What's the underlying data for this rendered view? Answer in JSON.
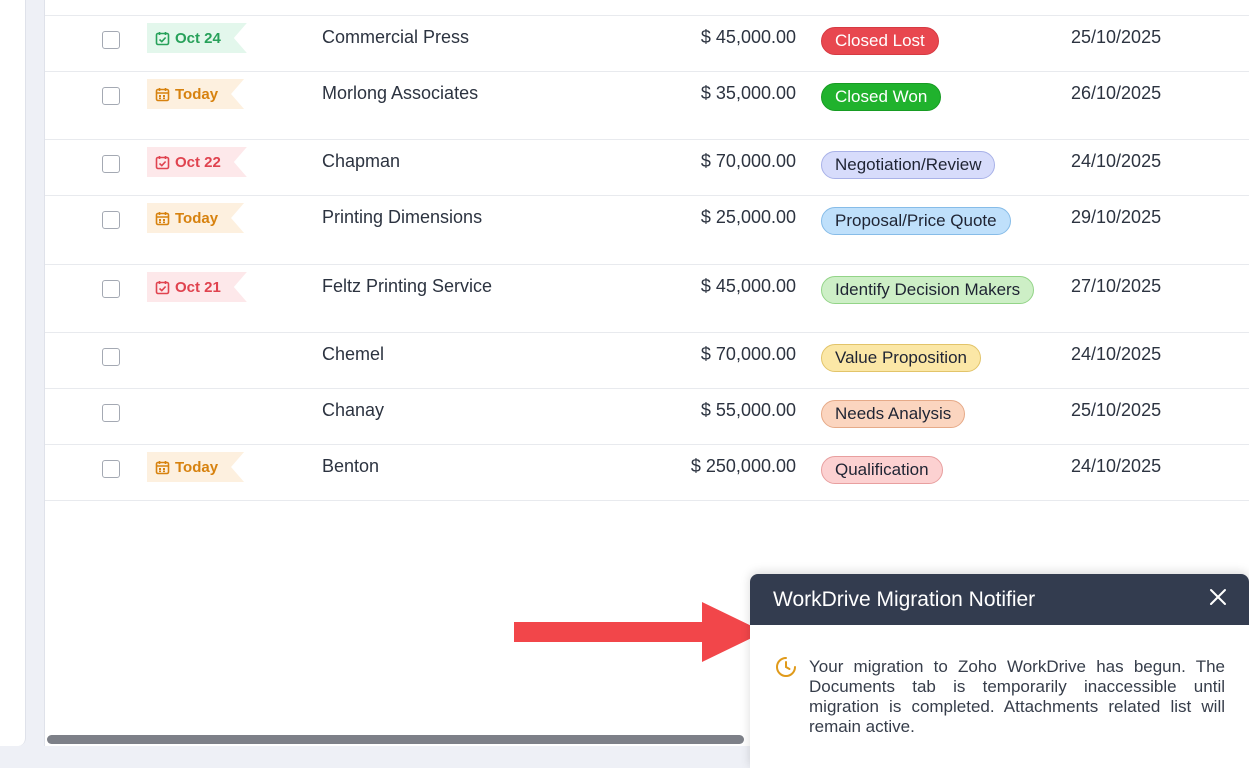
{
  "colors": {
    "header_bg": "#333c4f",
    "arrow": "#f2464a",
    "flag_green": "#27a15a",
    "flag_orange": "#d7820f",
    "flag_red": "#e0434f"
  },
  "rows": [
    {
      "flag": "Oct 24",
      "flag_color": "green",
      "flag_icon": "calendar-check-icon",
      "deal": "Commercial Press",
      "amount": "$ 45,000.00",
      "stage": "Closed Lost",
      "stage_bg": "#e8474f",
      "stage_fg": "#ffffff",
      "stage_border": "#d63a42",
      "date": "25/10/2025"
    },
    {
      "flag": "Today",
      "flag_color": "orange",
      "flag_icon": "calendar-icon",
      "deal": "Morlong Associates",
      "amount": "$ 35,000.00",
      "stage": "Closed Won",
      "stage_bg": "#20b22d",
      "stage_fg": "#ffffff",
      "stage_border": "#179c23",
      "date": "26/10/2025"
    },
    {
      "flag": "Oct 22",
      "flag_color": "red",
      "flag_icon": "calendar-check-icon",
      "deal": "Chapman",
      "amount": "$ 70,000.00",
      "stage": "Negotiation/Review",
      "stage_bg": "#d7dcfb",
      "stage_fg": "#1f2433",
      "stage_border": "#a9b2e8",
      "date": "24/10/2025"
    },
    {
      "flag": "Today",
      "flag_color": "orange",
      "flag_icon": "calendar-icon",
      "deal": "Printing Dimensions",
      "amount": "$ 25,000.00",
      "stage": "Proposal/Price Quote",
      "stage_bg": "#bfe0fb",
      "stage_fg": "#1f2433",
      "stage_border": "#86bce8",
      "date": "29/10/2025"
    },
    {
      "flag": "Oct 21",
      "flag_color": "red",
      "flag_icon": "calendar-check-icon",
      "deal": "Feltz Printing Service",
      "amount": "$ 45,000.00",
      "stage": "Identify Decision Makers",
      "stage_bg": "#cdefc6",
      "stage_fg": "#1f2433",
      "stage_border": "#93d488",
      "date": "27/10/2025"
    },
    {
      "flag": "",
      "flag_color": "",
      "flag_icon": "",
      "deal": "Chemel",
      "amount": "$ 70,000.00",
      "stage": "Value Proposition",
      "stage_bg": "#fbe7a6",
      "stage_fg": "#1f2433",
      "stage_border": "#e2c46a",
      "date": "24/10/2025"
    },
    {
      "flag": "",
      "flag_color": "",
      "flag_icon": "",
      "deal": "Chanay",
      "amount": "$ 55,000.00",
      "stage": "Needs Analysis",
      "stage_bg": "#fbd5bf",
      "stage_fg": "#1f2433",
      "stage_border": "#e6aa88",
      "date": "25/10/2025"
    },
    {
      "flag": "Today",
      "flag_color": "orange",
      "flag_icon": "calendar-icon",
      "deal": "Benton",
      "amount": "$ 250,000.00",
      "stage": "Qualification",
      "stage_bg": "#fcd1d1",
      "stage_fg": "#1f2433",
      "stage_border": "#e89f9f",
      "date": "24/10/2025"
    }
  ],
  "notifier": {
    "title": "WorkDrive Migration Notifier",
    "close_icon": "close-icon",
    "status_icon": "clock-icon",
    "message": "Your migration to Zoho WorkDrive has begun. The Documents tab is temporarily inaccessible until migration is completed. Attachments related list will remain active."
  }
}
